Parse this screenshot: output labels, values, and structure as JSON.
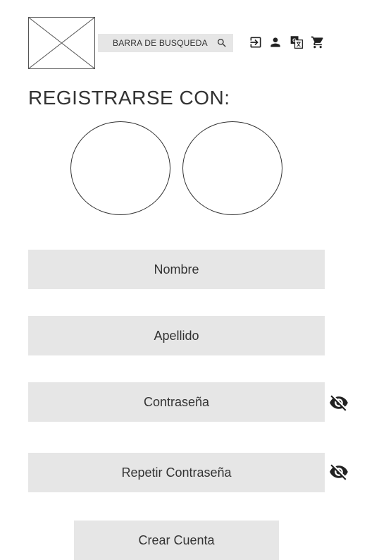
{
  "header": {
    "search": {
      "text": "BARRA DE BUSQUEDA",
      "icon": "search-icon"
    },
    "icons": [
      "login-icon",
      "user-icon",
      "translate-icon",
      "cart-icon"
    ]
  },
  "register": {
    "title": "REGISTRARSE CON:",
    "social_buttons": [
      "social-login-option",
      "social-login-option"
    ]
  },
  "form": {
    "nombre_placeholder": "Nombre",
    "apellido_placeholder": "Apellido",
    "password_placeholder": "Contraseña",
    "repeat_password_placeholder": "Repetir Contraseña",
    "visibility_icon": "eye-off-icon",
    "submit_label": "Crear Cuenta"
  },
  "colors": {
    "field_background": "#e6e6e6",
    "text": "#333333",
    "page_background": "#ffffff"
  }
}
